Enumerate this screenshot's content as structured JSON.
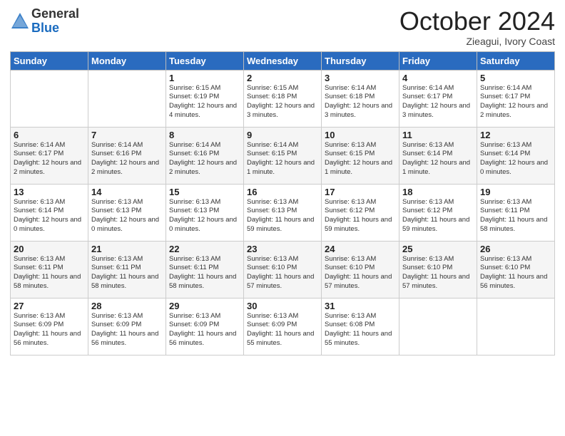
{
  "logo": {
    "general": "General",
    "blue": "Blue"
  },
  "header": {
    "month": "October 2024",
    "location": "Zieagui, Ivory Coast"
  },
  "days_of_week": [
    "Sunday",
    "Monday",
    "Tuesday",
    "Wednesday",
    "Thursday",
    "Friday",
    "Saturday"
  ],
  "weeks": [
    [
      null,
      null,
      {
        "day": 1,
        "sunrise": "Sunrise: 6:15 AM",
        "sunset": "Sunset: 6:19 PM",
        "daylight": "Daylight: 12 hours and 4 minutes."
      },
      {
        "day": 2,
        "sunrise": "Sunrise: 6:15 AM",
        "sunset": "Sunset: 6:18 PM",
        "daylight": "Daylight: 12 hours and 3 minutes."
      },
      {
        "day": 3,
        "sunrise": "Sunrise: 6:14 AM",
        "sunset": "Sunset: 6:18 PM",
        "daylight": "Daylight: 12 hours and 3 minutes."
      },
      {
        "day": 4,
        "sunrise": "Sunrise: 6:14 AM",
        "sunset": "Sunset: 6:17 PM",
        "daylight": "Daylight: 12 hours and 3 minutes."
      },
      {
        "day": 5,
        "sunrise": "Sunrise: 6:14 AM",
        "sunset": "Sunset: 6:17 PM",
        "daylight": "Daylight: 12 hours and 2 minutes."
      }
    ],
    [
      {
        "day": 6,
        "sunrise": "Sunrise: 6:14 AM",
        "sunset": "Sunset: 6:17 PM",
        "daylight": "Daylight: 12 hours and 2 minutes."
      },
      {
        "day": 7,
        "sunrise": "Sunrise: 6:14 AM",
        "sunset": "Sunset: 6:16 PM",
        "daylight": "Daylight: 12 hours and 2 minutes."
      },
      {
        "day": 8,
        "sunrise": "Sunrise: 6:14 AM",
        "sunset": "Sunset: 6:16 PM",
        "daylight": "Daylight: 12 hours and 2 minutes."
      },
      {
        "day": 9,
        "sunrise": "Sunrise: 6:14 AM",
        "sunset": "Sunset: 6:15 PM",
        "daylight": "Daylight: 12 hours and 1 minute."
      },
      {
        "day": 10,
        "sunrise": "Sunrise: 6:13 AM",
        "sunset": "Sunset: 6:15 PM",
        "daylight": "Daylight: 12 hours and 1 minute."
      },
      {
        "day": 11,
        "sunrise": "Sunrise: 6:13 AM",
        "sunset": "Sunset: 6:14 PM",
        "daylight": "Daylight: 12 hours and 1 minute."
      },
      {
        "day": 12,
        "sunrise": "Sunrise: 6:13 AM",
        "sunset": "Sunset: 6:14 PM",
        "daylight": "Daylight: 12 hours and 0 minutes."
      }
    ],
    [
      {
        "day": 13,
        "sunrise": "Sunrise: 6:13 AM",
        "sunset": "Sunset: 6:14 PM",
        "daylight": "Daylight: 12 hours and 0 minutes."
      },
      {
        "day": 14,
        "sunrise": "Sunrise: 6:13 AM",
        "sunset": "Sunset: 6:13 PM",
        "daylight": "Daylight: 12 hours and 0 minutes."
      },
      {
        "day": 15,
        "sunrise": "Sunrise: 6:13 AM",
        "sunset": "Sunset: 6:13 PM",
        "daylight": "Daylight: 12 hours and 0 minutes."
      },
      {
        "day": 16,
        "sunrise": "Sunrise: 6:13 AM",
        "sunset": "Sunset: 6:13 PM",
        "daylight": "Daylight: 11 hours and 59 minutes."
      },
      {
        "day": 17,
        "sunrise": "Sunrise: 6:13 AM",
        "sunset": "Sunset: 6:12 PM",
        "daylight": "Daylight: 11 hours and 59 minutes."
      },
      {
        "day": 18,
        "sunrise": "Sunrise: 6:13 AM",
        "sunset": "Sunset: 6:12 PM",
        "daylight": "Daylight: 11 hours and 59 minutes."
      },
      {
        "day": 19,
        "sunrise": "Sunrise: 6:13 AM",
        "sunset": "Sunset: 6:11 PM",
        "daylight": "Daylight: 11 hours and 58 minutes."
      }
    ],
    [
      {
        "day": 20,
        "sunrise": "Sunrise: 6:13 AM",
        "sunset": "Sunset: 6:11 PM",
        "daylight": "Daylight: 11 hours and 58 minutes."
      },
      {
        "day": 21,
        "sunrise": "Sunrise: 6:13 AM",
        "sunset": "Sunset: 6:11 PM",
        "daylight": "Daylight: 11 hours and 58 minutes."
      },
      {
        "day": 22,
        "sunrise": "Sunrise: 6:13 AM",
        "sunset": "Sunset: 6:11 PM",
        "daylight": "Daylight: 11 hours and 58 minutes."
      },
      {
        "day": 23,
        "sunrise": "Sunrise: 6:13 AM",
        "sunset": "Sunset: 6:10 PM",
        "daylight": "Daylight: 11 hours and 57 minutes."
      },
      {
        "day": 24,
        "sunrise": "Sunrise: 6:13 AM",
        "sunset": "Sunset: 6:10 PM",
        "daylight": "Daylight: 11 hours and 57 minutes."
      },
      {
        "day": 25,
        "sunrise": "Sunrise: 6:13 AM",
        "sunset": "Sunset: 6:10 PM",
        "daylight": "Daylight: 11 hours and 57 minutes."
      },
      {
        "day": 26,
        "sunrise": "Sunrise: 6:13 AM",
        "sunset": "Sunset: 6:10 PM",
        "daylight": "Daylight: 11 hours and 56 minutes."
      }
    ],
    [
      {
        "day": 27,
        "sunrise": "Sunrise: 6:13 AM",
        "sunset": "Sunset: 6:09 PM",
        "daylight": "Daylight: 11 hours and 56 minutes."
      },
      {
        "day": 28,
        "sunrise": "Sunrise: 6:13 AM",
        "sunset": "Sunset: 6:09 PM",
        "daylight": "Daylight: 11 hours and 56 minutes."
      },
      {
        "day": 29,
        "sunrise": "Sunrise: 6:13 AM",
        "sunset": "Sunset: 6:09 PM",
        "daylight": "Daylight: 11 hours and 56 minutes."
      },
      {
        "day": 30,
        "sunrise": "Sunrise: 6:13 AM",
        "sunset": "Sunset: 6:09 PM",
        "daylight": "Daylight: 11 hours and 55 minutes."
      },
      {
        "day": 31,
        "sunrise": "Sunrise: 6:13 AM",
        "sunset": "Sunset: 6:08 PM",
        "daylight": "Daylight: 11 hours and 55 minutes."
      },
      null,
      null
    ]
  ]
}
